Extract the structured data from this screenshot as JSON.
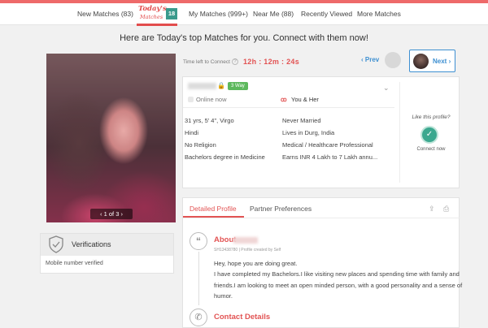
{
  "nav": {
    "new_matches": "New Matches (83)",
    "today_word": "Today's",
    "today_sub": "Matches",
    "today_count": "18",
    "my_matches": "My Matches (999+)",
    "near_me": "Near Me (88)",
    "recently_viewed": "Recently Viewed",
    "more_matches": "More Matches"
  },
  "headline": "Here are Today's top Matches for you. Connect with them now!",
  "photo": {
    "pager": "1 of 3"
  },
  "verifications": {
    "title": "Verifications",
    "text": "Mobile number verified"
  },
  "timer": {
    "label": "Time left to Connect",
    "value": "12h : 12m : 24s"
  },
  "navigation": {
    "prev": "Prev",
    "next": "Next"
  },
  "profile": {
    "tag": "3 Way",
    "online": "Online now",
    "match": "You & Her",
    "details": {
      "age": "31 yrs, 5' 4\", Virgo",
      "marital": "Never Married",
      "language": "Hindi",
      "location": "Lives in Durg, India",
      "religion": "No Religion",
      "profession": "Medical / Healthcare Professional",
      "education": "Bachelors degree in Medicine",
      "income": "Earns INR 4 Lakh to 7 Lakh annu..."
    },
    "like_label": "Like this profile?",
    "connect_label": "Connect now"
  },
  "detail_tabs": {
    "active": "Detailed Profile",
    "inactive": "Partner Preferences"
  },
  "about": {
    "title": "About",
    "meta": "SH13438780  |  Profile created by Self",
    "lines": [
      "Hey, hope you are doing great.",
      "I have completed my Bachelors.I like visiting new places and spending time with family and",
      "friends.I am looking to meet an open minded person, with a good personality and a sense of",
      "humor."
    ]
  },
  "contact": {
    "title": "Contact Details"
  },
  "colors": {
    "accent": "#e25353",
    "link": "#3d8fd1",
    "connect": "#3ba88f"
  }
}
